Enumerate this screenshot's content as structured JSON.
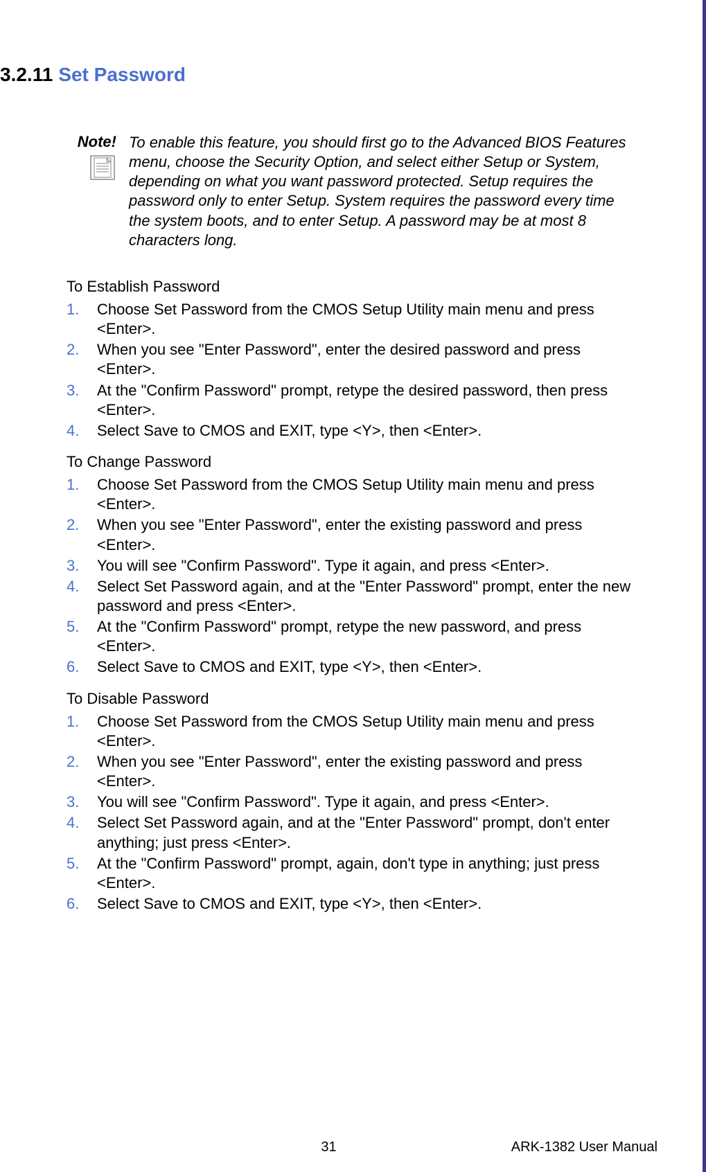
{
  "section": {
    "number": "3.2.11",
    "title": "Set Password"
  },
  "note": {
    "label": "Note!",
    "text": "To enable this feature, you should first go to the Advanced BIOS Features menu, choose the Security Option, and select either Setup or System, depending on what you want password protected. Setup requires the password only to enter Setup. System requires the password every time the system boots, and to enter Setup. A password may be at most 8 characters long."
  },
  "groups": [
    {
      "heading": "To Establish Password",
      "items": [
        "Choose Set Password from the CMOS Setup Utility main menu and press <Enter>.",
        "When you see \"Enter Password\", enter the desired password and press <Enter>.",
        "At the \"Confirm Password\" prompt, retype the desired password, then press <Enter>.",
        "Select Save to CMOS and EXIT, type <Y>, then <Enter>."
      ]
    },
    {
      "heading": "To Change Password",
      "items": [
        "Choose Set Password from the CMOS Setup Utility main menu and press <Enter>.",
        " When you see \"Enter Password\", enter the existing password and press <Enter>.",
        "You will see \"Confirm Password\". Type it again, and press <Enter>.",
        "Select Set Password again, and at the \"Enter Password\" prompt, enter the new password and press <Enter>.",
        "At the \"Confirm Password\" prompt, retype the new password, and press <Enter>.",
        "Select Save to CMOS and EXIT, type <Y>, then <Enter>."
      ]
    },
    {
      "heading": "To Disable Password",
      "items": [
        "Choose Set Password from the CMOS Setup Utility main menu and press <Enter>.",
        "When you see \"Enter Password\", enter the existing password and press <Enter>.",
        "You will see \"Confirm Password\". Type it again, and press <Enter>.",
        "Select Set Password again, and at the \"Enter Password\" prompt, don't enter anything; just press <Enter>.",
        "At the \"Confirm Password\" prompt, again, don't type in anything; just press <Enter>.",
        "Select Save to CMOS and EXIT, type <Y>, then <Enter>."
      ]
    }
  ],
  "footer": {
    "page_number": "31",
    "manual_title": "ARK-1382 User Manual"
  }
}
